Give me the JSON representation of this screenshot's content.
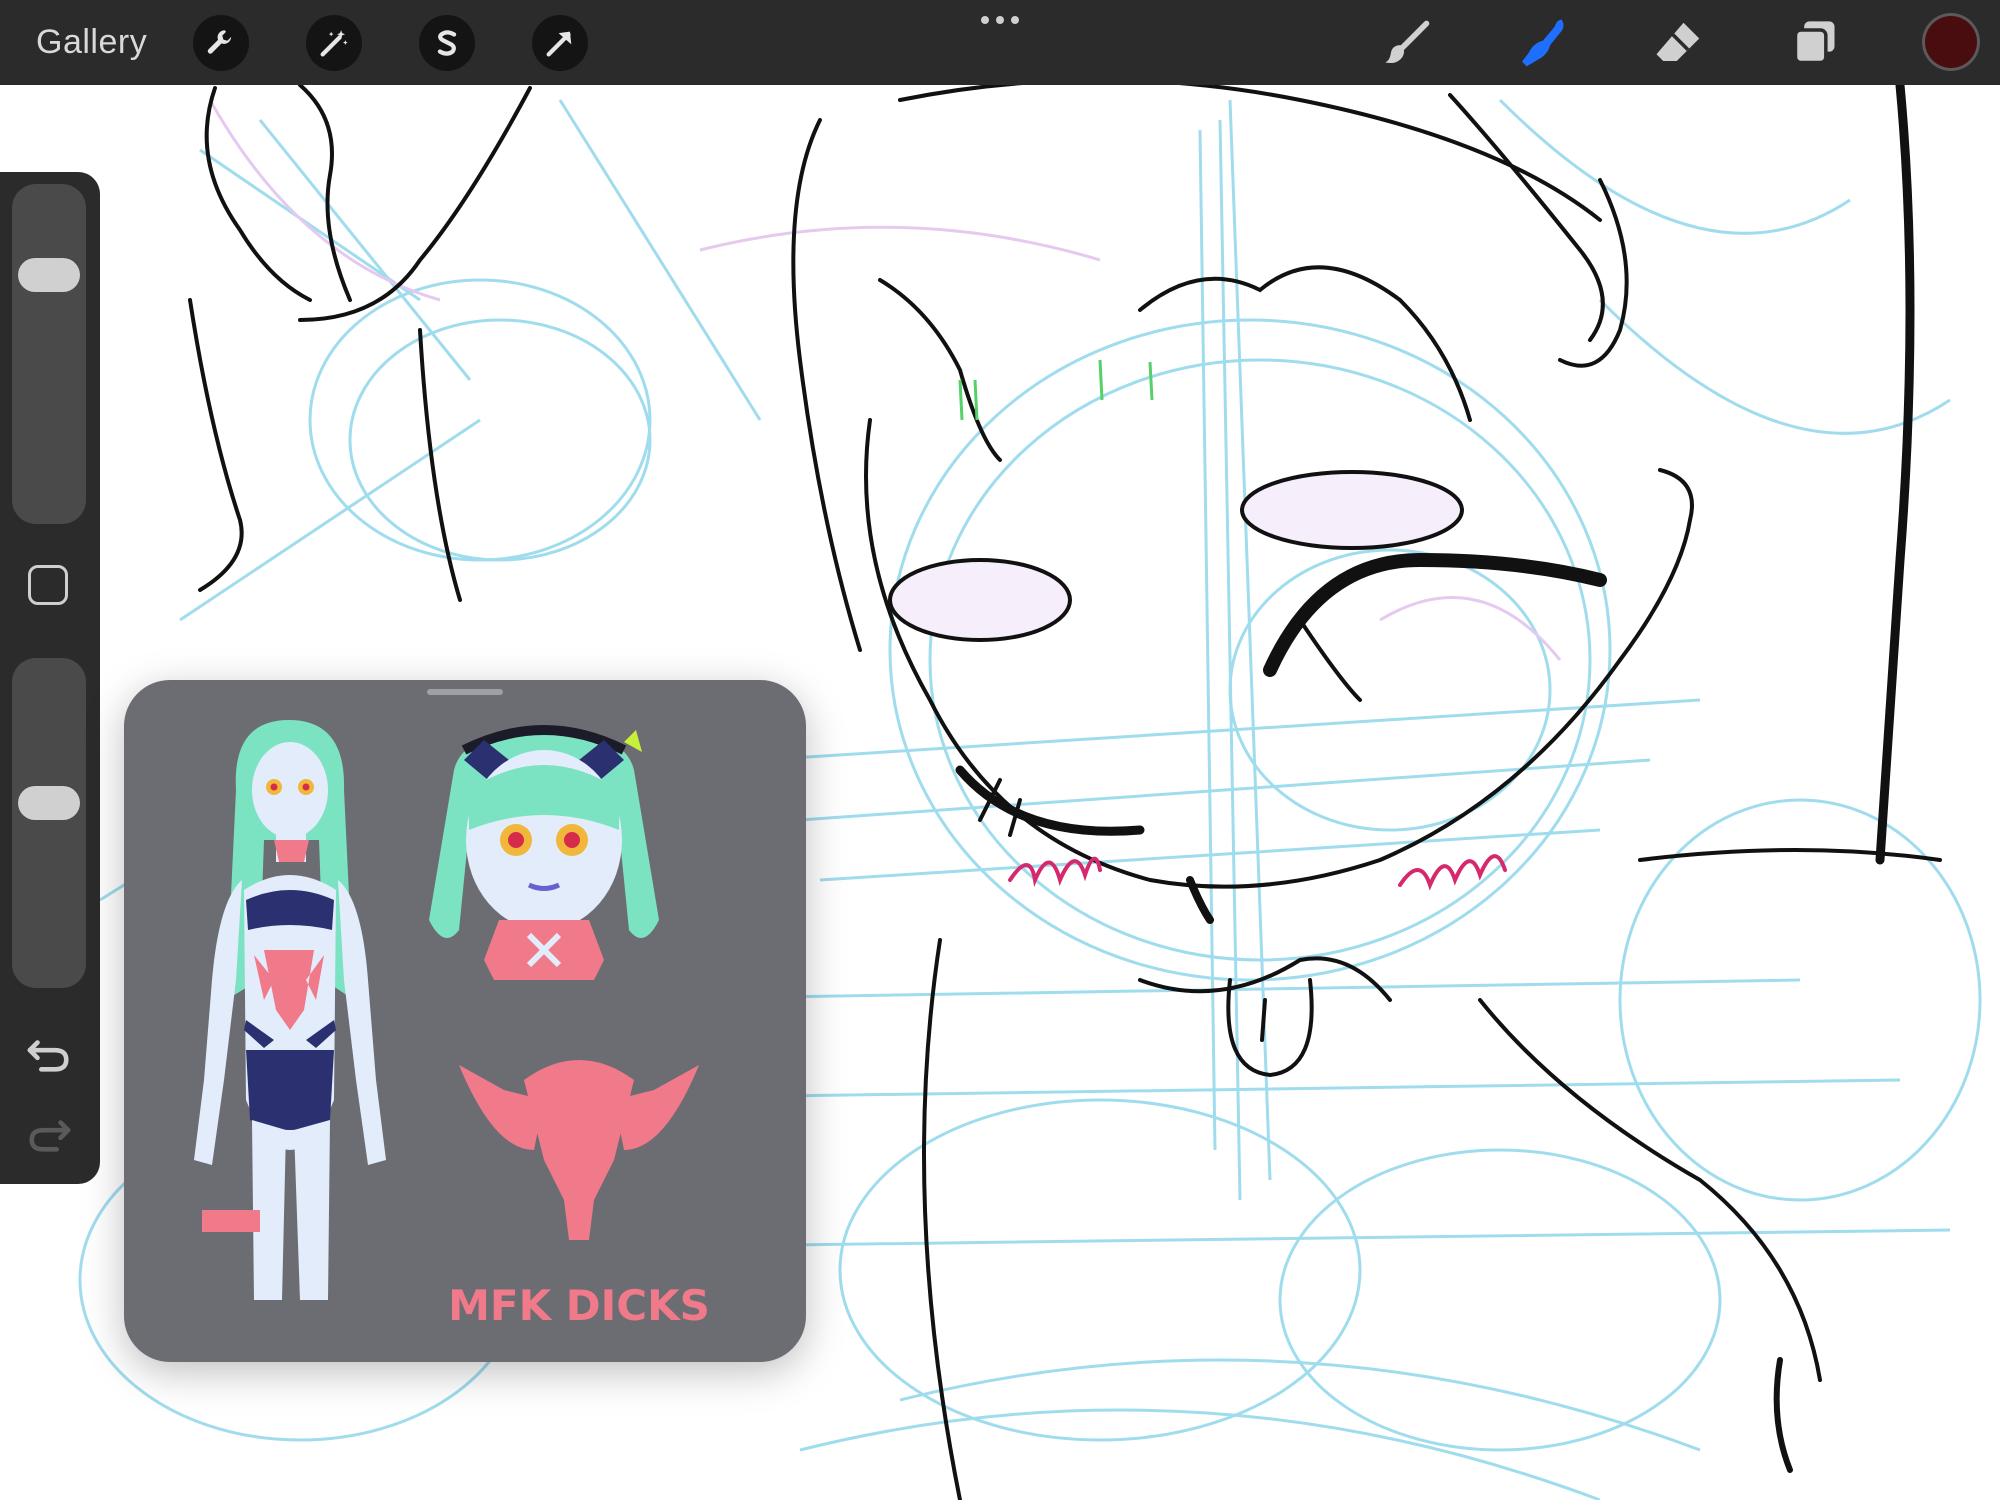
{
  "app": {
    "gallery_label": "Gallery"
  },
  "toolbar": {
    "left_tools": [
      "wrench-icon",
      "magic-wand-icon",
      "selection-s-icon",
      "arrow-transform-icon"
    ],
    "right_tools": [
      "brush-icon",
      "smudge-icon",
      "eraser-icon",
      "layers-icon"
    ],
    "active_tool": "smudge-icon",
    "active_color": "#4a0d0f",
    "accent_color": "#1f6fff"
  },
  "sidebar": {
    "brush_size_level": 0.22,
    "opacity_level": 0.45
  },
  "reference": {
    "bottom_text": "MFK DICKS",
    "colors": {
      "hair": "#7be3c1",
      "skin": "#e3ecfb",
      "pink": "#f07a8a",
      "navy": "#2b3170",
      "eyes": "#f0b73a"
    }
  }
}
